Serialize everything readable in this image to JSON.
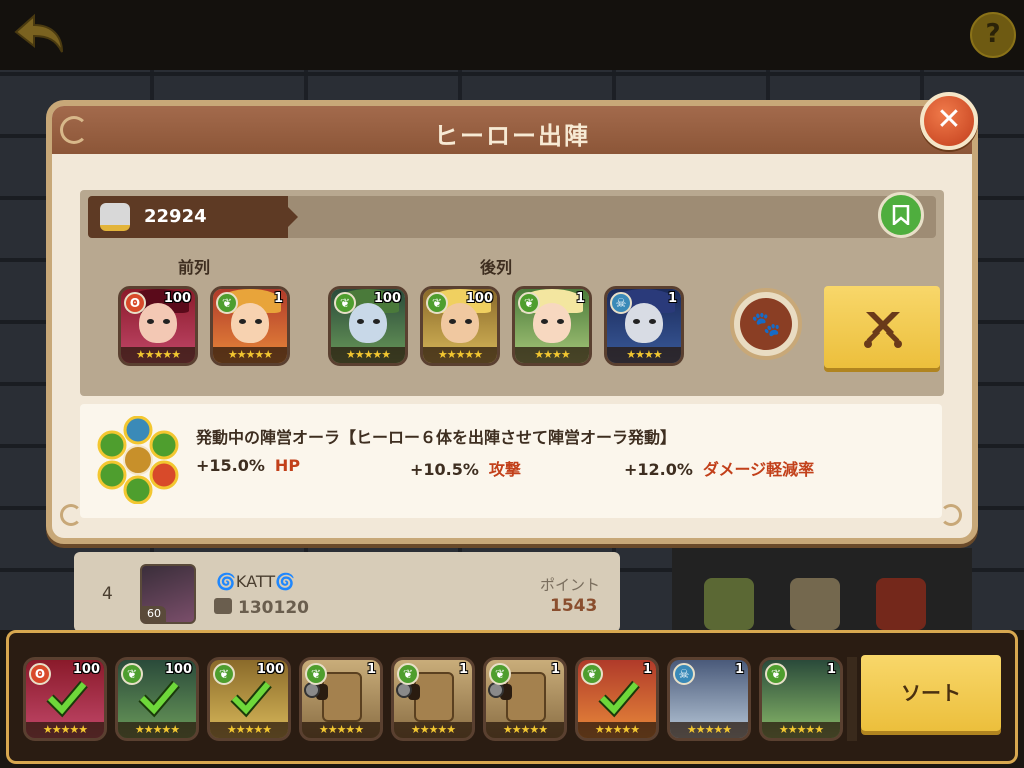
{
  "modal": {
    "title": "ヒーロー出陣",
    "close_label": "✕"
  },
  "power": {
    "value": "22924"
  },
  "rows": {
    "front_label": "前列",
    "back_label": "後列"
  },
  "lineup": [
    {
      "faction": "fire",
      "level": "100",
      "stars": "★★★★★"
    },
    {
      "faction": "nature",
      "level": "1",
      "stars": "★★★★★"
    },
    {
      "faction": "nature",
      "level": "100",
      "stars": "★★★★★"
    },
    {
      "faction": "nature",
      "level": "100",
      "stars": "★★★★★"
    },
    {
      "faction": "nature",
      "level": "1",
      "stars": "★★★★"
    },
    {
      "faction": "skull",
      "level": "1",
      "stars": "★★★★"
    }
  ],
  "aura": {
    "title": "発動中の陣営オーラ【ヒーロー６体を出陣させて陣営オーラ発動】",
    "stats": [
      {
        "value": "+15.0%",
        "name": "HP"
      },
      {
        "value": "+10.5%",
        "name": "攻撃"
      },
      {
        "value": "+12.0%",
        "name": "ダメージ軽減率"
      }
    ]
  },
  "ranking": {
    "rank": "4",
    "name": "KATT",
    "avatar_level": "60",
    "power": "130120",
    "points_label": "ポイント",
    "points": "1543"
  },
  "roster": [
    {
      "faction": "fire",
      "level": "100",
      "stars": "★★★★★",
      "selected": true
    },
    {
      "faction": "nature",
      "level": "100",
      "stars": "★★★★★",
      "selected": true
    },
    {
      "faction": "nature",
      "level": "100",
      "stars": "★★★★★",
      "selected": true
    },
    {
      "faction": "nature",
      "level": "1",
      "stars": "★★★★★",
      "selected": false
    },
    {
      "faction": "nature",
      "level": "1",
      "stars": "★★★★★",
      "selected": false
    },
    {
      "faction": "nature",
      "level": "1",
      "stars": "★★★★★",
      "selected": false
    },
    {
      "faction": "nature",
      "level": "1",
      "stars": "★★★★★",
      "selected": true
    },
    {
      "faction": "skull",
      "level": "1",
      "stars": "★★★★★",
      "selected": false
    },
    {
      "faction": "nature",
      "level": "1",
      "stars": "★★★★★",
      "selected": false
    }
  ],
  "sort_label": "ソート",
  "help_label": "?"
}
